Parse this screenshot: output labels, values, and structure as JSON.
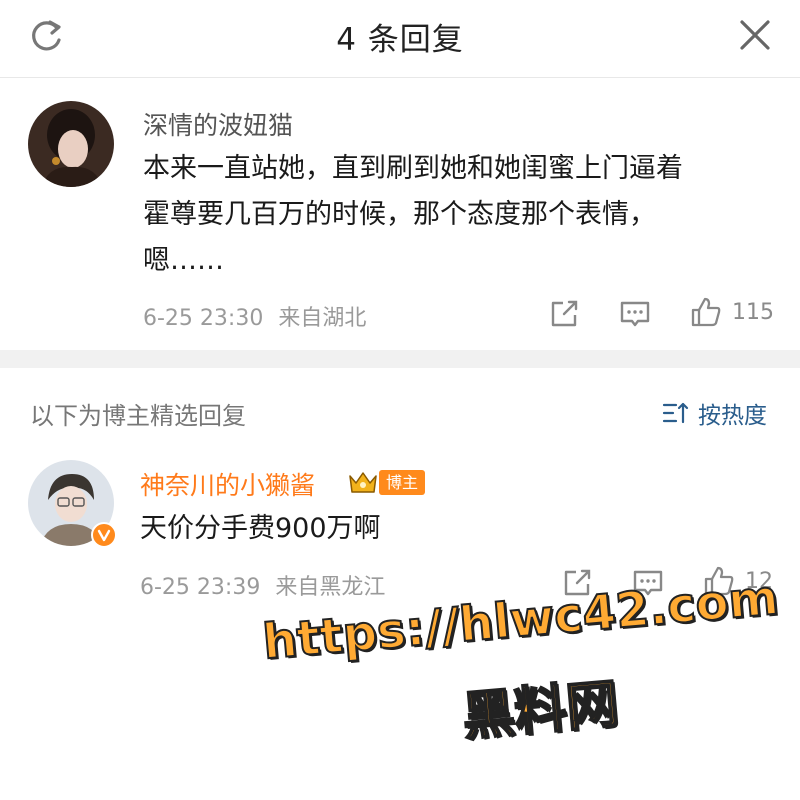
{
  "header": {
    "title": "4 条回复",
    "refresh_icon": "refresh-icon",
    "close_icon": "close-icon"
  },
  "comment": {
    "author": "深情的波妞猫",
    "text_lines": [
      "本来一直站她，直到刷到她和她闺蜜上门逼着",
      "霍尊要几百万的时候，那个态度那个表情，",
      "嗯……"
    ],
    "time": "6-25 23:30",
    "location": "来自湖北",
    "likes": "115"
  },
  "section": {
    "title": "以下为博主精选回复",
    "sort_label": "按热度"
  },
  "reply": {
    "author": "神奈川的小獭酱",
    "badge": "博主",
    "text": "天价分手费900万啊",
    "time": "6-25 23:39",
    "location": "来自黑龙江",
    "likes": "12",
    "author_color": "#ff7a1a"
  },
  "watermark": {
    "url": "https://hlwc42.com",
    "name": "黑料网"
  },
  "colors": {
    "accent": "#ff7a1a",
    "link": "#2a5d8c",
    "watermark": "#ffaa33"
  }
}
